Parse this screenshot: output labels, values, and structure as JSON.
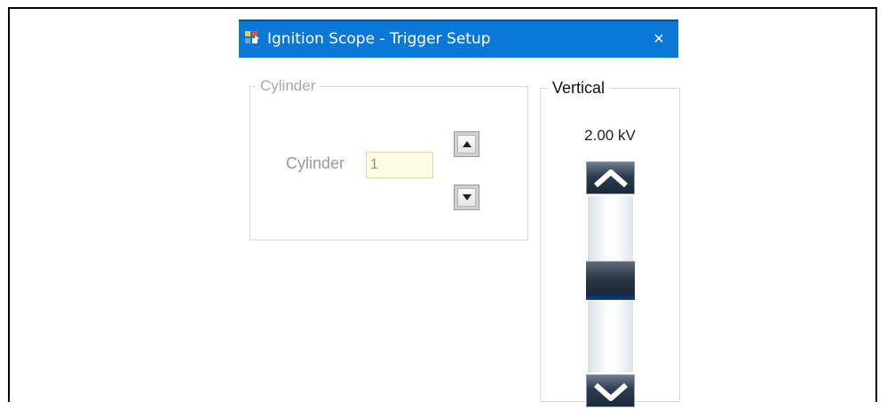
{
  "window": {
    "title": "Ignition Scope - Trigger Setup",
    "close_glyph": "×",
    "title_bar_color": "#0a78d7"
  },
  "cylinder_group": {
    "legend": "Cylinder",
    "label": "Cylinder",
    "value": "1",
    "up_icon": "triangle-up-icon",
    "down_icon": "triangle-down-icon"
  },
  "vertical_group": {
    "legend": "Vertical",
    "value": "2.00 kV",
    "up_icon": "chevron-up-icon",
    "down_icon": "chevron-down-icon"
  }
}
